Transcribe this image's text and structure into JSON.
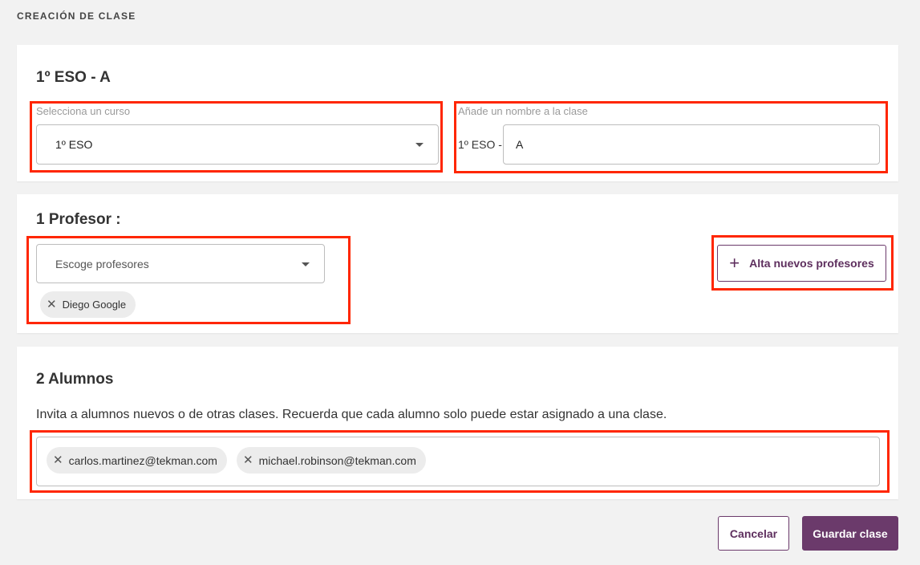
{
  "page": {
    "title": "CREACIÓN DE CLASE"
  },
  "clase": {
    "heading": "1º ESO - A",
    "curso_label": "Selecciona un curso",
    "curso_value": "1º ESO",
    "nombre_label": "Añade un nombre a la clase",
    "nombre_prefix": "1º ESO -",
    "nombre_value": "A"
  },
  "profesores": {
    "heading": "1 Profesor :",
    "select_placeholder": "Escoge profesores",
    "chips": [
      "Diego Google"
    ],
    "add_button": "Alta nuevos profesores"
  },
  "alumnos": {
    "heading": "2 Alumnos",
    "description": "Invita a alumnos nuevos o de otras clases. Recuerda que cada alumno solo puede estar asignado a una clase.",
    "chips": [
      "carlos.martinez@tekman.com",
      "michael.robinson@tekman.com"
    ]
  },
  "actions": {
    "cancel": "Cancelar",
    "save": "Guardar clase"
  },
  "colors": {
    "accent": "#6b3a6b",
    "highlight": "#ff2600"
  }
}
